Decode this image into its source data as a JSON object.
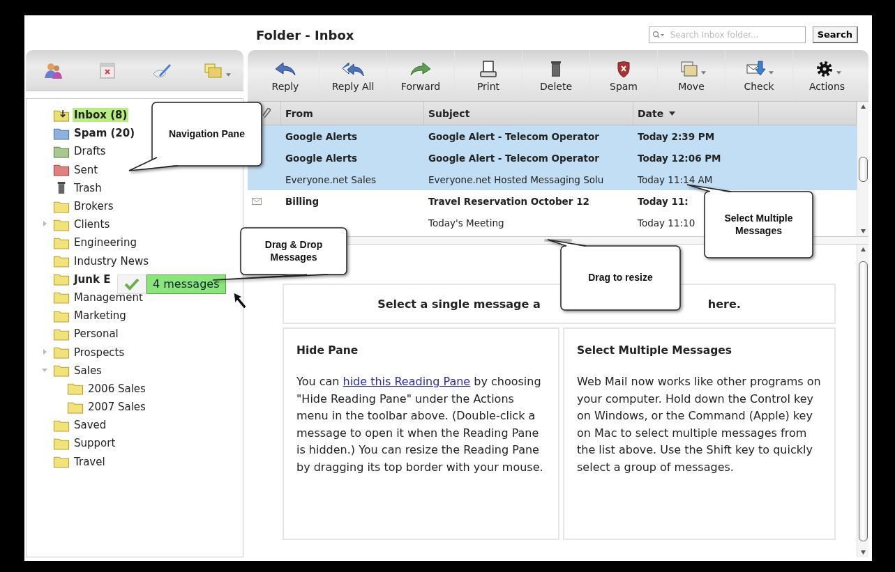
{
  "header": {
    "title": "Folder - Inbox",
    "search": {
      "placeholder": "Search Inbox folder...",
      "button": "Search"
    }
  },
  "toolbar": [
    {
      "label": "Reply",
      "has_menu": false
    },
    {
      "label": "Reply All",
      "has_menu": false
    },
    {
      "label": "Forward",
      "has_menu": false
    },
    {
      "label": "Print",
      "has_menu": false
    },
    {
      "label": "Delete",
      "has_menu": false
    },
    {
      "label": "Spam",
      "has_menu": false
    },
    {
      "label": "Move",
      "has_menu": true
    },
    {
      "label": "Check",
      "has_menu": true
    },
    {
      "label": "Actions",
      "has_menu": true
    }
  ],
  "folders": [
    {
      "name": "Inbox (8)",
      "kind": "inbox",
      "unread": true,
      "selected": true
    },
    {
      "name": "Spam (20)",
      "kind": "spam",
      "unread": true,
      "selected": false
    },
    {
      "name": "Drafts",
      "kind": "drafts",
      "unread": false,
      "selected": false
    },
    {
      "name": "Sent",
      "kind": "sent",
      "unread": false,
      "selected": false
    },
    {
      "name": "Trash",
      "kind": "trash",
      "unread": false,
      "selected": false
    },
    {
      "name": "Brokers",
      "kind": "folder",
      "unread": false,
      "selected": false
    },
    {
      "name": "Clients",
      "kind": "folder",
      "unread": false,
      "selected": false,
      "expanded": false
    },
    {
      "name": "Engineering",
      "kind": "folder",
      "unread": false,
      "selected": false
    },
    {
      "name": "Industry News",
      "kind": "folder",
      "unread": false,
      "selected": false
    },
    {
      "name": "Junk E",
      "kind": "folder",
      "unread": true,
      "selected": false
    },
    {
      "name": "Management",
      "kind": "folder",
      "unread": false,
      "selected": false
    },
    {
      "name": "Marketing",
      "kind": "folder",
      "unread": false,
      "selected": false
    },
    {
      "name": "Personal",
      "kind": "folder",
      "unread": false,
      "selected": false
    },
    {
      "name": "Prospects",
      "kind": "folder",
      "unread": false,
      "selected": false,
      "expanded": false
    },
    {
      "name": "Sales",
      "kind": "folder",
      "unread": false,
      "selected": false,
      "expanded": true,
      "children": [
        {
          "name": "2006 Sales",
          "kind": "folder",
          "unread": false,
          "selected": false
        },
        {
          "name": "2007 Sales",
          "kind": "folder",
          "unread": false,
          "selected": false
        }
      ]
    },
    {
      "name": "Saved",
      "kind": "folder",
      "unread": false,
      "selected": false
    },
    {
      "name": "Support",
      "kind": "folder",
      "unread": false,
      "selected": false
    },
    {
      "name": "Travel",
      "kind": "folder",
      "unread": false,
      "selected": false
    }
  ],
  "drag": {
    "label": "4 messages"
  },
  "messages": {
    "columns": [
      {
        "label": "From",
        "sorted": false
      },
      {
        "label": "Subject",
        "sorted": false
      },
      {
        "label": "Date",
        "sorted": true
      }
    ],
    "rows": [
      {
        "kind": "plain",
        "from": "Google Alerts",
        "subject": "Google Alert - Telecom Operator",
        "date": "Today 2:39 PM",
        "unread": true,
        "selected": true
      },
      {
        "kind": "plain",
        "from": "Google Alerts",
        "subject": "Google Alert - Telecom Operator",
        "date": "Today 12:06 PM",
        "unread": true,
        "selected": true
      },
      {
        "kind": "plain",
        "from": "Everyone.net Sales",
        "subject": "Everyone.net Hosted Messaging Solu",
        "date": "Today 11:14 AM",
        "unread": false,
        "selected": true
      },
      {
        "kind": "envelope",
        "from": "Billing",
        "subject": "Travel Reservation October 12",
        "date": "Today 11:",
        "unread": true,
        "selected": false
      },
      {
        "kind": "plain",
        "subject": "Today's Meeting",
        "date": "Today 11:10",
        "unread": false,
        "selected": false
      }
    ]
  },
  "reading_pane": {
    "heading_parts": [
      "Select a single message a",
      "here."
    ],
    "cards": [
      {
        "title": "Hide Pane",
        "before": "You can ",
        "link": "hide this Reading Pane",
        "after": " by choosing \"Hide Reading Pane\" under the Actions menu in the toolbar above. (Double-click a message to open it when the Reading Pane is hidden.) You can resize the Reading Pane by dragging its top border with your mouse."
      },
      {
        "title": "Select Multiple Messages",
        "before": "Web Mail now works like other programs on your computer. Hold down the Control key on Windows, or the Command (Apple) key on Mac to select multiple messages from the list above. Use the Shift key to quickly select a group of messages."
      }
    ]
  },
  "callouts": [
    {
      "text": "Navigation Pane"
    },
    {
      "text": "Drag & Drop Messages"
    },
    {
      "text": "Drag to resize"
    },
    {
      "text": "Select Multiple Messages"
    }
  ]
}
